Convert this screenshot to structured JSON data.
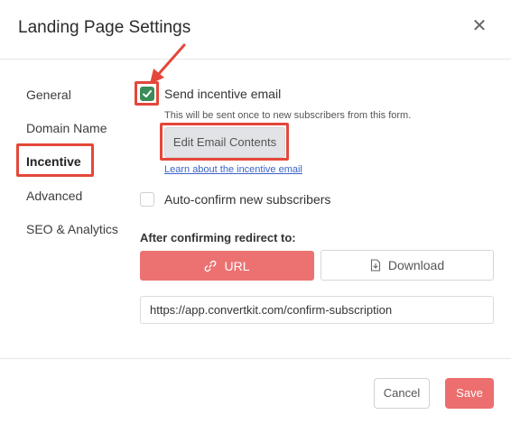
{
  "dialog": {
    "title": "Landing Page Settings",
    "close_icon": "close-icon"
  },
  "sidebar": {
    "items": [
      {
        "label": "General",
        "active": false
      },
      {
        "label": "Domain Name",
        "active": false
      },
      {
        "label": "Incentive",
        "active": true
      },
      {
        "label": "Advanced",
        "active": false
      },
      {
        "label": "SEO & Analytics",
        "active": false
      }
    ]
  },
  "incentive": {
    "send_email_label": "Send incentive email",
    "send_email_checked": true,
    "send_email_hint": "This will be sent once to new subscribers from this form.",
    "edit_button": "Edit Email Contents",
    "learn_link": "Learn about the incentive email",
    "auto_confirm_label": "Auto-confirm new subscribers",
    "auto_confirm_checked": false
  },
  "redirect": {
    "section_label": "After confirming redirect to:",
    "url_button": "URL",
    "download_button": "Download",
    "url_value": "https://app.convertkit.com/confirm-subscription"
  },
  "footer": {
    "cancel": "Cancel",
    "save": "Save"
  },
  "colors": {
    "accent": "#ec7272",
    "highlight": "#e4473a",
    "check": "#3c8c5a",
    "link": "#3b63c7"
  }
}
